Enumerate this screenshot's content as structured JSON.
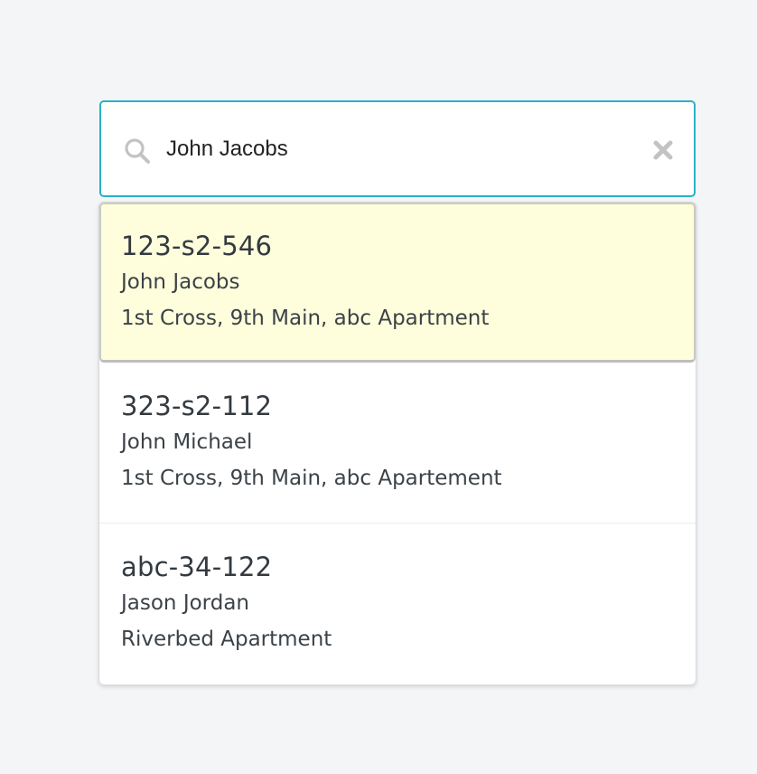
{
  "search": {
    "value": "John Jacobs",
    "icon": "search-icon",
    "clear_icon": "close-icon"
  },
  "results": [
    {
      "id": "123-s2-546",
      "name": "John Jacobs",
      "address": "1st Cross, 9th Main, abc Apartment",
      "highlighted": true
    },
    {
      "id": "323-s2-112",
      "name": "John Michael",
      "address": "1st Cross, 9th Main, abc Apartement",
      "highlighted": false
    },
    {
      "id": "abc-34-122",
      "name": "Jason Jordan",
      "address": "Riverbed Apartment",
      "highlighted": false
    }
  ],
  "colors": {
    "accent": "#2bb0c8",
    "highlight": "#fefedc",
    "background": "#f4f5f7"
  }
}
